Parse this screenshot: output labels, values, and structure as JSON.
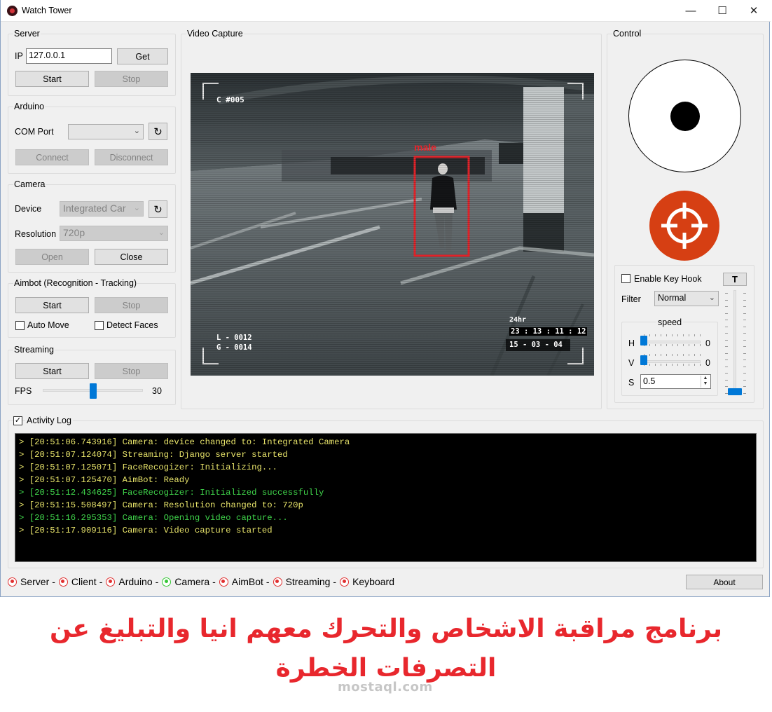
{
  "window": {
    "title": "Watch Tower",
    "controls": {
      "minimize": "—",
      "maximize": "☐",
      "close": "✕"
    }
  },
  "server": {
    "title": "Server",
    "ip_label": "IP",
    "ip_value": "127.0.0.1",
    "get_label": "Get",
    "start_label": "Start",
    "stop_label": "Stop"
  },
  "arduino": {
    "title": "Arduino",
    "com_label": "COM Port",
    "com_value": "",
    "connect_label": "Connect",
    "disconnect_label": "Disconnect"
  },
  "camera": {
    "title": "Camera",
    "device_label": "Device",
    "device_value": "Integrated Car",
    "resolution_label": "Resolution",
    "resolution_value": "720p",
    "open_label": "Open",
    "close_label": "Close"
  },
  "aimbot": {
    "title": "Aimbot (Recognition - Tracking)",
    "start_label": "Start",
    "stop_label": "Stop",
    "auto_move_label": "Auto Move",
    "detect_faces_label": "Detect Faces",
    "auto_move_checked": false,
    "detect_faces_checked": false
  },
  "streaming": {
    "title": "Streaming",
    "start_label": "Start",
    "stop_label": "Stop",
    "fps_label": "FPS",
    "fps_value": "30",
    "fps_fraction": 0.5
  },
  "video": {
    "title": "Video Capture",
    "cam_id": "C #005",
    "detection_label": "male",
    "overlay_l": "L - 0012",
    "overlay_g": "G - 0014",
    "overlay_mode": "24hr",
    "overlay_time": "23 : 13 : 11 : 12",
    "overlay_date": "15 - 03 - 04"
  },
  "control": {
    "title": "Control",
    "enable_key_hook_label": "Enable Key Hook",
    "enable_key_hook_checked": false,
    "t_label": "T",
    "filter_label": "Filter",
    "filter_value": "Normal",
    "speed_title": "speed",
    "h_label": "H",
    "h_value": "0",
    "v_label": "V",
    "v_value": "0",
    "s_label": "S",
    "s_value": "0.5",
    "vertical_slider_fraction": 0.0
  },
  "activity_log": {
    "label": "Activity Log",
    "checked": true,
    "entries": [
      {
        "prompt": "> ",
        "text": "[20:51:06.743916] Camera: device changed to: Integrated Camera",
        "color": "#e7e36a"
      },
      {
        "prompt": "> ",
        "text": "[20:51:07.124074] Streaming: Django server started",
        "color": "#e7e36a"
      },
      {
        "prompt": "> ",
        "text": "[20:51:07.125071] FaceRecogizer: Initializing...",
        "color": "#e7e36a"
      },
      {
        "prompt": "> ",
        "text": "[20:51:07.125470] AimBot: Ready",
        "color": "#e7e36a"
      },
      {
        "prompt": "> ",
        "text": "[20:51:12.434625] FaceRecogizer: Initialized successfully",
        "color": "#3fd34a"
      },
      {
        "prompt": "> ",
        "text": "[20:51:15.508497] Camera: Resolution changed to: 720p",
        "color": "#e7e36a"
      },
      {
        "prompt": "> ",
        "text": "[20:51:16.295353] Camera: Opening video capture...",
        "color": "#3fd34a"
      },
      {
        "prompt": "> ",
        "text": "[20:51:17.909116] Camera: Video capture started",
        "color": "#e7e36a"
      }
    ]
  },
  "status": {
    "items": [
      {
        "label": "Server",
        "state": "off"
      },
      {
        "label": "Client",
        "state": "off"
      },
      {
        "label": "Arduino",
        "state": "off"
      },
      {
        "label": "Camera",
        "state": "on"
      },
      {
        "label": "AimBot",
        "state": "off"
      },
      {
        "label": "Streaming",
        "state": "off"
      },
      {
        "label": "Keyboard",
        "state": "off"
      }
    ],
    "separator": "-",
    "about_label": "About"
  },
  "caption": {
    "line1": "برنامج مراقبة الاشخاص والتحرك معهم انيا والتبليغ عن",
    "line2": "التصرفات الخطرة",
    "watermark": "mostaql.com"
  },
  "colors": {
    "accent": "#0078d7",
    "target_button": "#d63f13",
    "caption": "#e8272d",
    "status_off": "#e03030",
    "status_on": "#37c837",
    "detection_box": "#e5242b"
  }
}
